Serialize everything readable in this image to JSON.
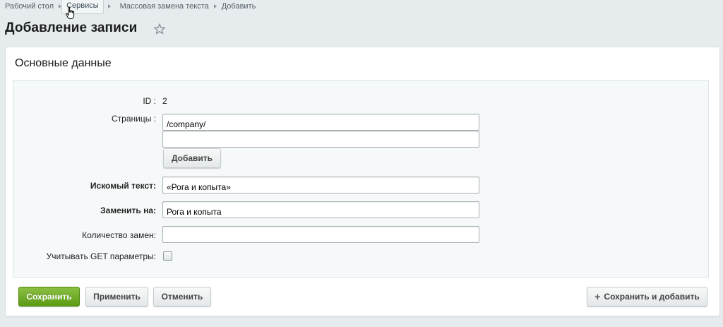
{
  "breadcrumbs": [
    "Рабочий стол",
    "Сервисы",
    "Массовая замена текста",
    "Добавить"
  ],
  "page": {
    "title": "Добавление записи"
  },
  "section": {
    "title": "Основные данные"
  },
  "form": {
    "id_label": "ID :",
    "id_value": "2",
    "pages_label": "Страницы :",
    "pages_values": [
      "/company/",
      ""
    ],
    "add_button": "Добавить",
    "search_label": "Искомый текст:",
    "search_value": "«Рога и копыта»",
    "replace_label": "Заменить на:",
    "replace_value": "Рога и копыта",
    "count_label": "Количество замен:",
    "count_value": "",
    "get_label": "Учитывать GET параметры:",
    "get_checked": false
  },
  "actions": {
    "save": "Сохранить",
    "apply": "Применить",
    "cancel": "Отменить",
    "save_add": "Сохранить и добавить"
  },
  "colors": {
    "accent_green": "#6aa822",
    "background": "#e6ebed"
  }
}
